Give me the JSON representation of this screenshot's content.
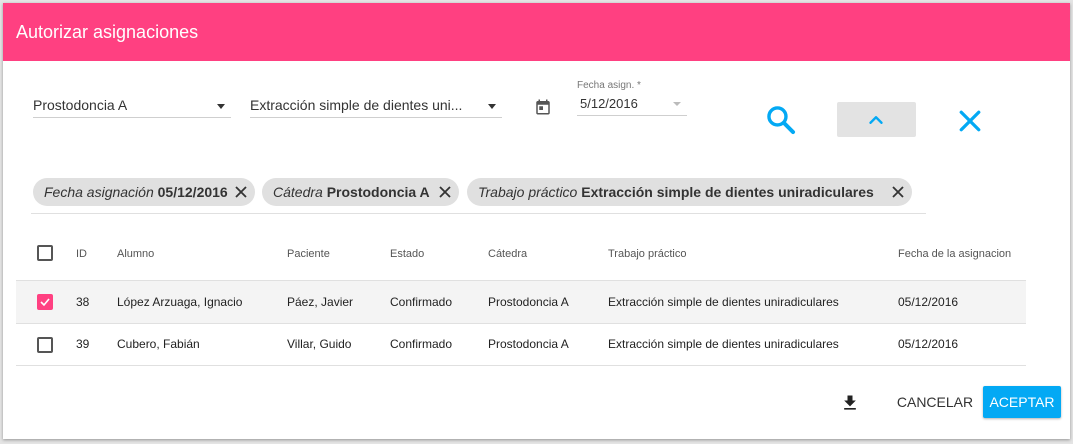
{
  "dialog": {
    "title": "Autorizar asignaciones"
  },
  "filters": {
    "catedra_select": {
      "value": "Prostodoncia A"
    },
    "trabajo_select": {
      "value": "Extracción simple de dientes uni..."
    },
    "fecha": {
      "label": "Fecha asign. *",
      "value": "5/12/2016"
    }
  },
  "toolbar": {
    "search_icon": "search-icon",
    "collapse_icon": "chevron-up-icon",
    "clear_icon": "close-icon"
  },
  "chips": [
    {
      "key": "Fecha asignación",
      "value": "05/12/2016"
    },
    {
      "key": "Cátedra",
      "value": "Prostodoncia A"
    },
    {
      "key": "Trabajo práctico",
      "value": "Extracción simple de dientes uniradiculares"
    }
  ],
  "table": {
    "headers": {
      "id": "ID",
      "alumno": "Alumno",
      "paciente": "Paciente",
      "estado": "Estado",
      "catedra": "Cátedra",
      "trabajo": "Trabajo práctico",
      "fecha": "Fecha de la asignacion"
    },
    "rows": [
      {
        "checked": true,
        "id": "38",
        "alumno": "López Arzuaga, Ignacio",
        "paciente": "Páez, Javier",
        "estado": "Confirmado",
        "catedra": "Prostodoncia A",
        "trabajo": "Extracción simple de dientes uniradiculares",
        "fecha": "05/12/2016"
      },
      {
        "checked": false,
        "id": "39",
        "alumno": "Cubero, Fabián",
        "paciente": "Villar, Guido",
        "estado": "Confirmado",
        "catedra": "Prostodoncia A",
        "trabajo": "Extracción simple de dientes uniradiculares",
        "fecha": "05/12/2016"
      }
    ]
  },
  "actions": {
    "download_icon": "download-icon",
    "cancel": "CANCELAR",
    "accept": "ACEPTAR"
  },
  "colors": {
    "header": "#ff4081",
    "accent": "#03a9f4",
    "checkbox_checked": "#ff4081"
  }
}
